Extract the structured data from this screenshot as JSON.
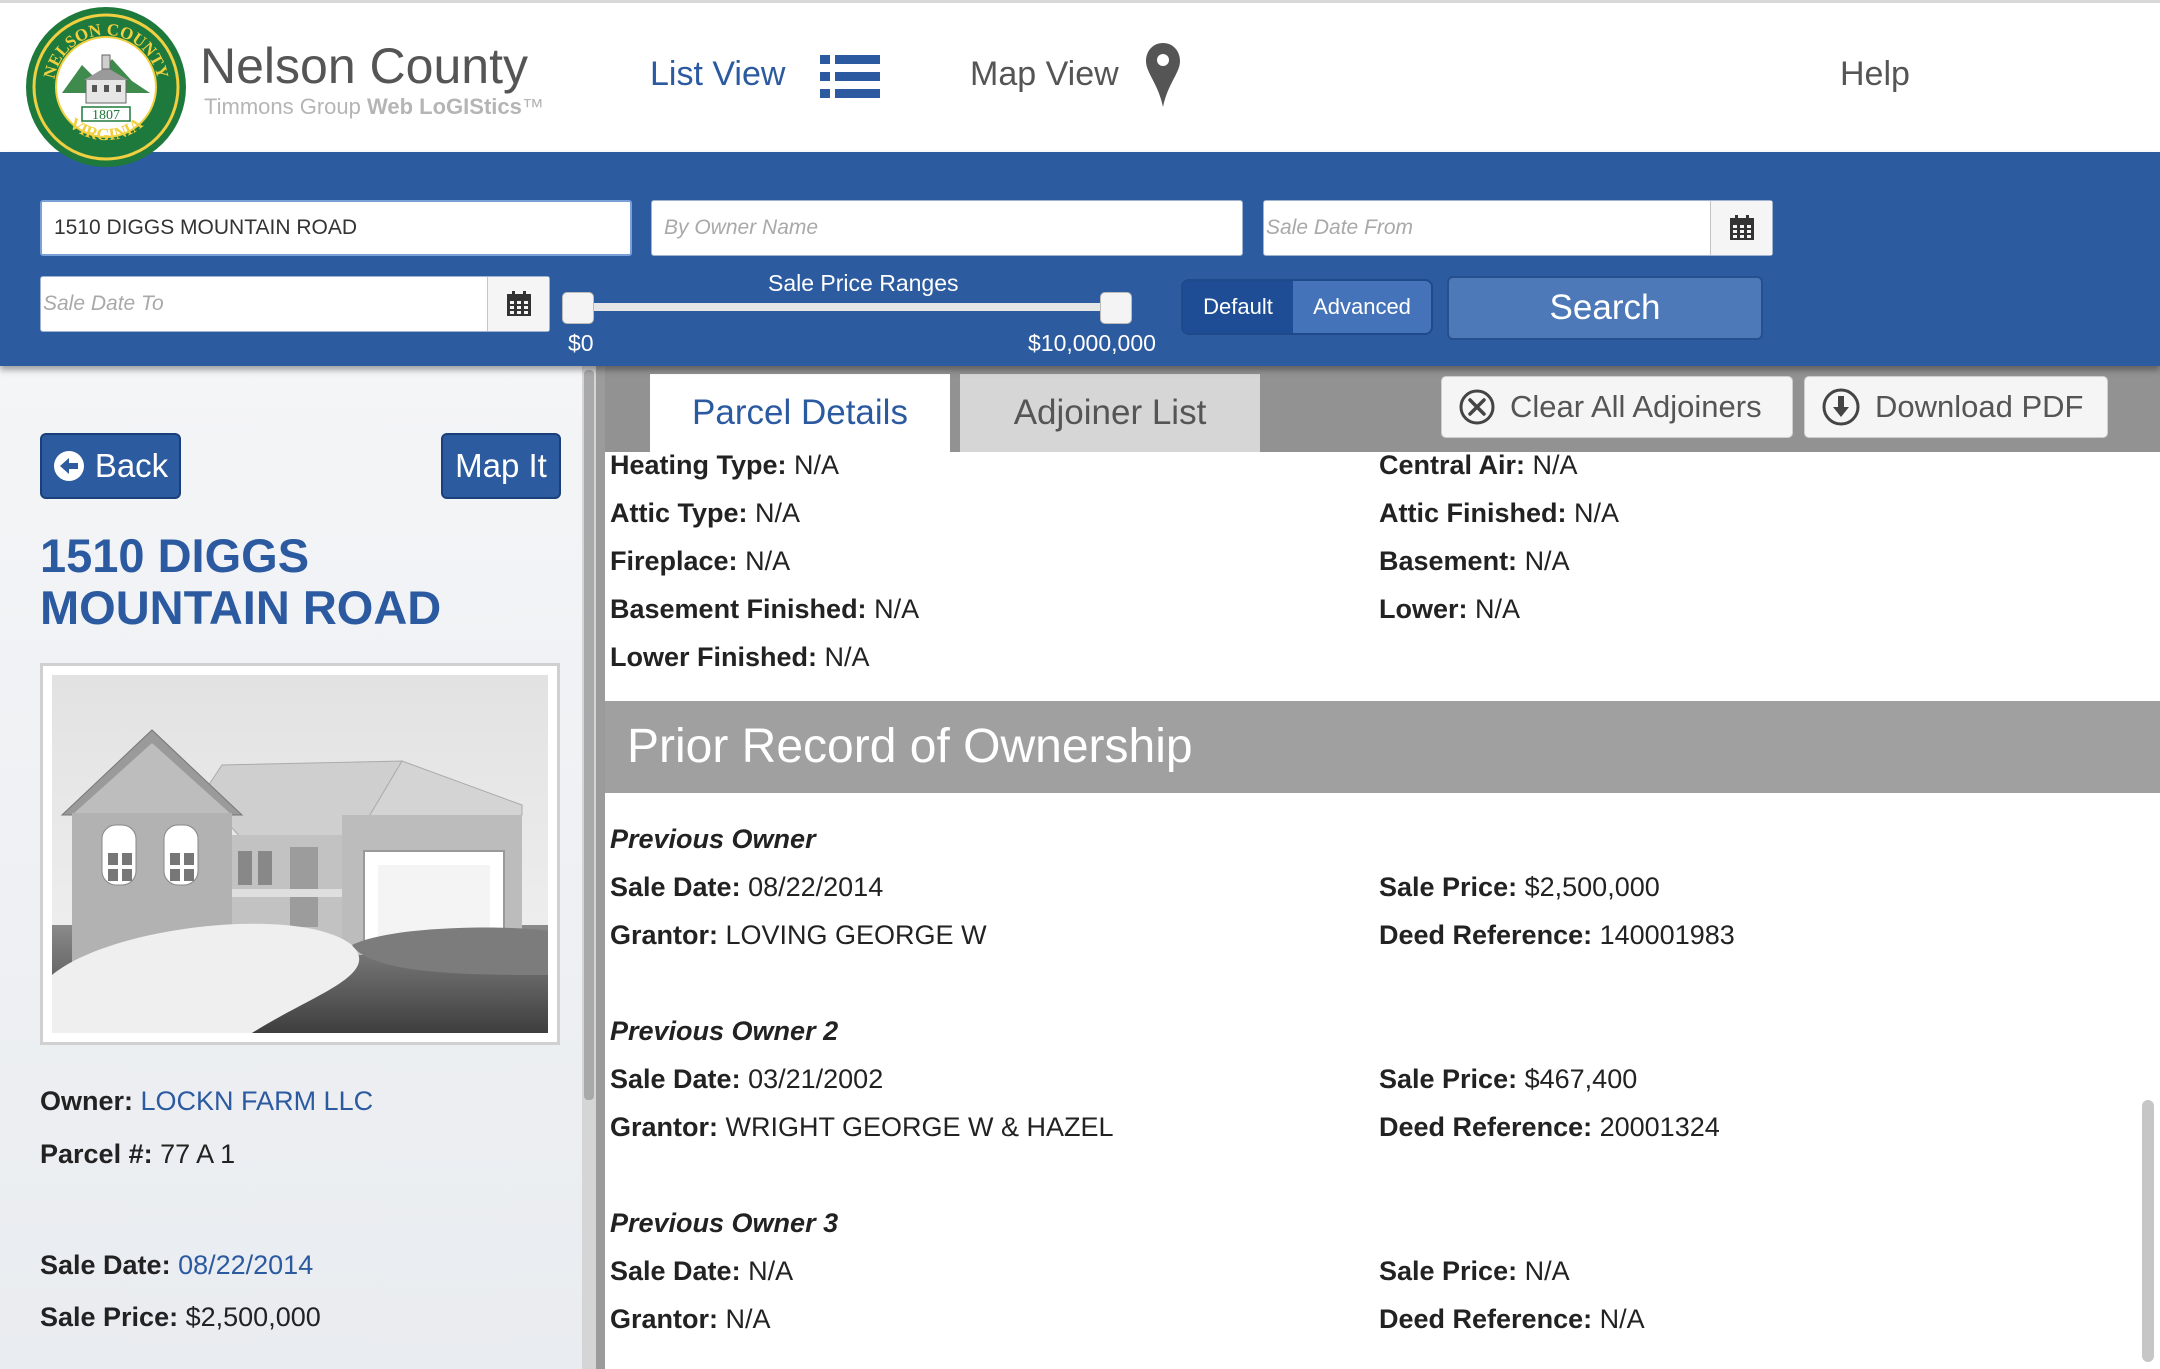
{
  "header": {
    "brand_name": "Nelson County",
    "brand_sub_prefix": "Timmons Group ",
    "brand_sub_bold": "Web LoGIStics",
    "brand_sub_tm": "™",
    "seal_top": "NELSON COUNTY",
    "seal_bottom": "VIRGINIA",
    "seal_year": "1807",
    "nav": {
      "list_view": "List View",
      "list_icon": "list-icon",
      "map_view": "Map View",
      "map_icon": "map-pin-icon",
      "help": "Help"
    }
  },
  "search": {
    "address_value": "1510 DIGGS MOUNTAIN ROAD",
    "owner_placeholder": "By Owner Name",
    "date_from_placeholder": "Sale Date From",
    "date_to_placeholder": "Sale Date To",
    "price_label": "Sale Price Ranges",
    "price_min": "$0",
    "price_max": "$10,000,000",
    "mode_default": "Default",
    "mode_advanced": "Advanced",
    "search_label": "Search"
  },
  "left": {
    "back_label": "Back",
    "mapit_label": "Map It",
    "title": "1510 DIGGS MOUNTAIN ROAD",
    "owner_label": "Owner:",
    "owner_value": "LOCKN FARM LLC",
    "parcel_label": "Parcel #:",
    "parcel_value": "77 A 1",
    "sale_date_label": "Sale Date:",
    "sale_date_value": "08/22/2014",
    "sale_price_label": "Sale Price:",
    "sale_price_value": "$2,500,000"
  },
  "tabs": {
    "parcel_details": "Parcel Details",
    "adjoiner_list": "Adjoiner List",
    "clear_adjoiners": "Clear All Adjoiners",
    "download_pdf": "Download PDF"
  },
  "details": [
    {
      "label": "Heating Type:",
      "value": "N/A"
    },
    {
      "label": "Central Air:",
      "value": "N/A"
    },
    {
      "label": "Attic Type:",
      "value": "N/A"
    },
    {
      "label": "Attic Finished:",
      "value": "N/A"
    },
    {
      "label": "Fireplace:",
      "value": "N/A"
    },
    {
      "label": "Basement:",
      "value": "N/A"
    },
    {
      "label": "Basement Finished:",
      "value": "N/A"
    },
    {
      "label": "Lower:",
      "value": "N/A"
    },
    {
      "label": "Lower Finished:",
      "value": "N/A"
    }
  ],
  "ownership": {
    "section_title": "Prior Record of Ownership",
    "labels": {
      "sale_date": "Sale Date:",
      "sale_price": "Sale Price:",
      "grantor": "Grantor:",
      "deed_reference": "Deed Reference:"
    },
    "owners": [
      {
        "heading": "Previous Owner",
        "sale_date": "08/22/2014",
        "sale_price": "$2,500,000",
        "grantor": "LOVING GEORGE W",
        "deed_reference": "140001983"
      },
      {
        "heading": "Previous Owner 2",
        "sale_date": "03/21/2002",
        "sale_price": "$467,400",
        "grantor": "WRIGHT GEORGE W & HAZEL",
        "deed_reference": "20001324"
      },
      {
        "heading": "Previous Owner 3",
        "sale_date": "N/A",
        "sale_price": "N/A",
        "grantor": "N/A",
        "deed_reference": "N/A"
      }
    ]
  },
  "colors": {
    "brand_blue": "#2c5ba0",
    "link_blue": "#2c5aa0",
    "section_gray": "#a0a0a0",
    "seal_green": "#1e7a3c"
  }
}
